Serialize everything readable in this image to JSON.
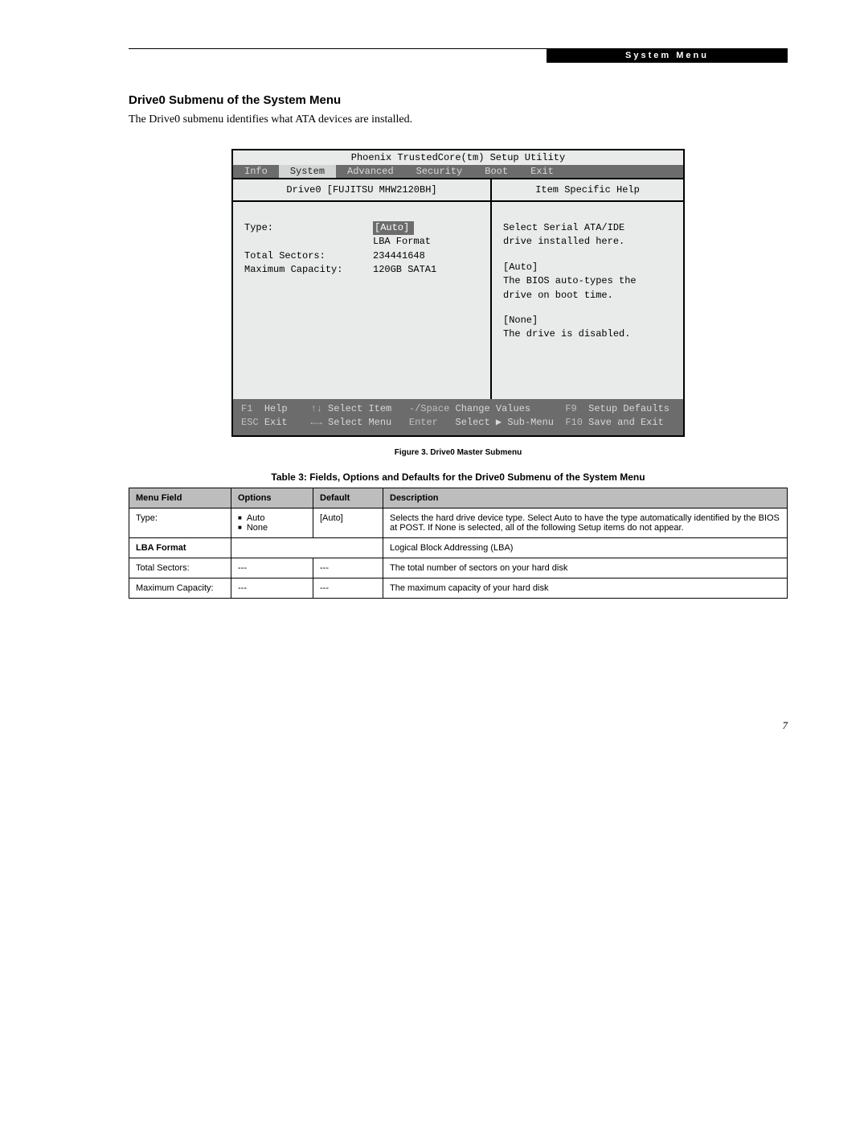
{
  "header": {
    "label": "System Menu"
  },
  "section": {
    "title": "Drive0 Submenu of the System Menu",
    "intro": "The Drive0 submenu identifies what ATA devices are installed."
  },
  "bios": {
    "title": "Phoenix TrustedCore(tm) Setup Utility",
    "tabs": [
      "Info",
      "System",
      "Advanced",
      "Security",
      "Boot",
      "Exit"
    ],
    "active_tab": "System",
    "sub_header_left": "Drive0 [FUJITSU MHW2120BH]",
    "sub_header_right": "Item Specific Help",
    "fields": {
      "type_label": "Type:",
      "type_value": "[Auto]",
      "lba_label": "LBA Format",
      "sectors_label": "Total Sectors:",
      "sectors_value": "234441648",
      "capacity_label": "Maximum Capacity:",
      "capacity_value": "120GB SATA1"
    },
    "help": {
      "line1": "Select Serial ATA/IDE",
      "line2": "drive installed here.",
      "line3": "[Auto]",
      "line4": "The BIOS auto-types the",
      "line5": "drive on boot time.",
      "line6": "[None]",
      "line7": "The drive is disabled."
    },
    "footer": {
      "f1": "F1",
      "help": "Help",
      "arrows_ud": "↑↓",
      "select_item": "Select Item",
      "minus_space": "-/Space",
      "change_values": "Change Values",
      "f9": "F9",
      "setup_defaults": "Setup Defaults",
      "esc": "ESC",
      "exit": "Exit",
      "arrows_lr": "←→",
      "select_menu": "Select Menu",
      "enter": "Enter",
      "select_submenu": "Select ▶ Sub-Menu",
      "f10": "F10",
      "save_exit": "Save and Exit"
    }
  },
  "figure_caption": "Figure 3.  Drive0 Master Submenu",
  "table_caption": "Table 3: Fields, Options and Defaults for the Drive0 Submenu of the System Menu",
  "table": {
    "headers": [
      "Menu Field",
      "Options",
      "Default",
      "Description"
    ],
    "rows": [
      {
        "field": "Type:",
        "options": [
          "Auto",
          "None"
        ],
        "default": "[Auto]",
        "desc": "Selects the hard drive device type. Select Auto to have the type automatically identified by the BIOS at POST. If None is selected, all of the following Setup items do not appear."
      },
      {
        "field_bold": "LBA Format",
        "desc": "Logical Block Addressing (LBA)"
      },
      {
        "field": "Total Sectors:",
        "options_text": "---",
        "default": "---",
        "desc": "The total number of sectors on your hard disk"
      },
      {
        "field": "Maximum Capacity:",
        "options_text": "---",
        "default": "---",
        "desc": "The maximum capacity of your hard disk"
      }
    ]
  },
  "page_number": "7"
}
